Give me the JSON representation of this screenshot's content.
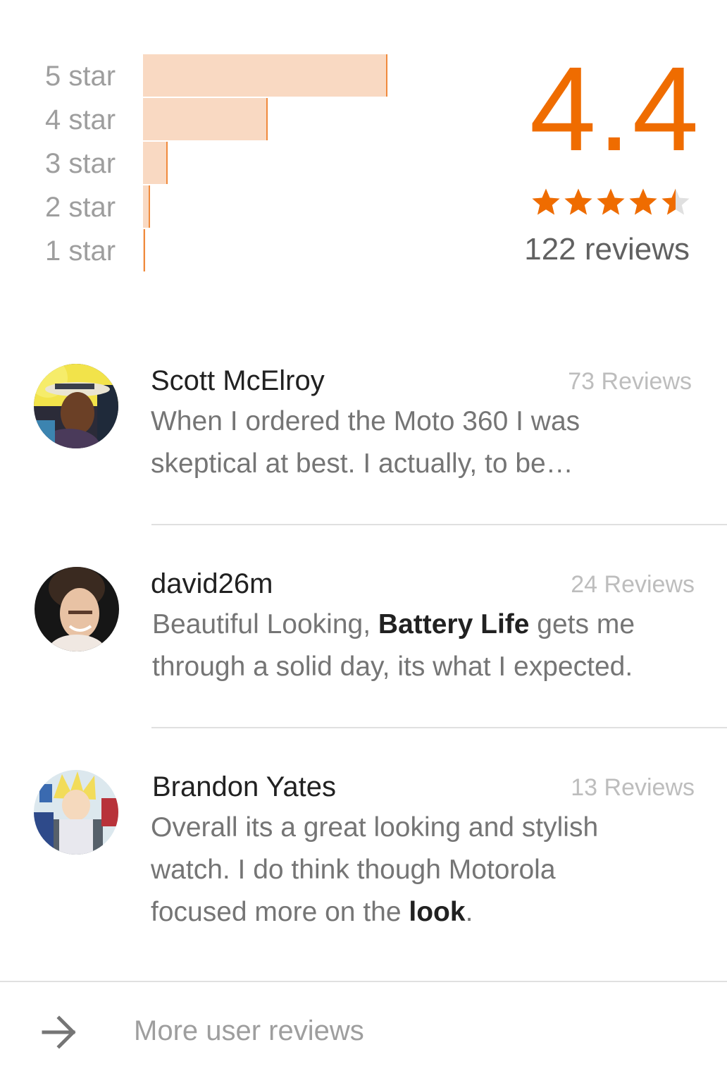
{
  "rating_summary": {
    "score": "4.4",
    "stars_value": 4.4,
    "stars_max": 5,
    "review_count": "122 reviews",
    "distribution": [
      {
        "label": "5 star",
        "fraction": 1.0
      },
      {
        "label": "4 star",
        "fraction": 0.51
      },
      {
        "label": "3 star",
        "fraction": 0.1
      },
      {
        "label": "2 star",
        "fraction": 0.03
      },
      {
        "label": "1 star",
        "fraction": 0.01
      }
    ],
    "accent_color": "#ef6c00",
    "bar_color": "#f9d9c2"
  },
  "reviews": [
    {
      "name": "Scott McElroy",
      "meta": "73 Reviews",
      "text_parts": [
        {
          "t": "When I ordered the Moto 360 I was skeptical at best. I actually, to be…",
          "bold": false
        }
      ]
    },
    {
      "name": "david26m",
      "meta": "24 Reviews",
      "text_parts": [
        {
          "t": "Beautiful Looking, ",
          "bold": false
        },
        {
          "t": "Battery Life",
          "bold": true
        },
        {
          "t": " gets me through a solid day, its what I expected.",
          "bold": false
        }
      ]
    },
    {
      "name": "Brandon Yates",
      "meta": "13 Reviews",
      "text_parts": [
        {
          "t": "Overall its a great looking and stylish watch. I do think though Motorola focused more on the ",
          "bold": false
        },
        {
          "t": "look",
          "bold": true
        },
        {
          "t": ".",
          "bold": false
        }
      ]
    }
  ],
  "footer": {
    "more_label": "More user reviews",
    "icon": "arrow-right-icon"
  }
}
